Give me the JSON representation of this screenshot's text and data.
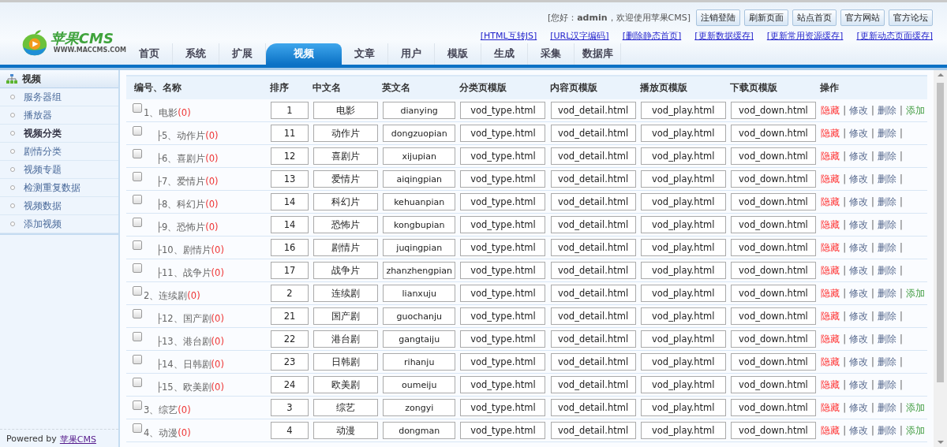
{
  "header": {
    "greeting": "[您好：**admin**，欢迎使用苹果CMS]",
    "buttons": [
      "注销登陆",
      "刷新页面",
      "站点首页",
      "官方网站",
      "官方论坛"
    ],
    "links": [
      "[HTML互转JS]",
      "[URL汉字编码]",
      "[删除静态首页]",
      "[更新数据缓存]",
      "[更新常用资源缓存]",
      "[更新动态页面缓存]"
    ],
    "logo": {
      "name": "苹果CMS",
      "url": "WWW.MACCMS.COM"
    }
  },
  "nav": [
    {
      "label": "首页",
      "selected": false
    },
    {
      "label": "系统",
      "selected": false
    },
    {
      "label": "扩展",
      "selected": false
    },
    {
      "label": "视频",
      "selected": true
    },
    {
      "label": "文章",
      "selected": false
    },
    {
      "label": "用户",
      "selected": false
    },
    {
      "label": "模版",
      "selected": false
    },
    {
      "label": "生成",
      "selected": false
    },
    {
      "label": "采集",
      "selected": false
    },
    {
      "label": "数据库",
      "selected": false
    }
  ],
  "sidebar": {
    "title": "视频",
    "items": [
      {
        "label": "服务器组",
        "selected": false
      },
      {
        "label": "播放器",
        "selected": false
      },
      {
        "label": "视频分类",
        "selected": true
      },
      {
        "label": "剧情分类",
        "selected": false
      },
      {
        "label": "视频专题",
        "selected": false
      },
      {
        "label": "检测重复数据",
        "selected": false
      },
      {
        "label": "视频数据",
        "selected": false
      },
      {
        "label": "添加视频",
        "selected": false
      }
    ],
    "footer": {
      "text": "Powered by",
      "link": "苹果CMS"
    }
  },
  "table": {
    "columns": [
      "编号、名称",
      "排序",
      "中文名",
      "英文名",
      "分类页模版",
      "内容页模版",
      "播放页模版",
      "下载页模版",
      "操作"
    ],
    "categories": [
      {
        "checked": false,
        "label": "1、电影",
        "count": "(0)",
        "sort": "1",
        "cn": "电影",
        "en": "dianying",
        "type": "vod_type.html",
        "detail": "vod_detail.html",
        "play": "vod_play.html",
        "down": "vod_down.html",
        "actions": [
          {
            "kind": "hide",
            "label": "隐藏",
            "sep": "|"
          },
          {
            "kind": "edit",
            "label": "修改",
            "sep": "|"
          },
          {
            "kind": "delete",
            "label": "删除",
            "sep": "|"
          },
          {
            "kind": "add",
            "label": "添加"
          }
        ],
        "children": [
          {
            "checked": false,
            "branch": "├",
            "label": "5、动作片",
            "count": "(0)",
            "sort": "11",
            "cn": "动作片",
            "en": "dongzuopian",
            "type": "vod_type.html",
            "detail": "vod_detail.html",
            "play": "vod_play.html",
            "down": "vod_down.html",
            "actions": [
              {
                "kind": "hide",
                "label": "隐藏",
                "sep": "|"
              },
              {
                "kind": "edit",
                "label": "修改",
                "sep": "|"
              },
              {
                "kind": "delete",
                "label": "删除",
                "sep": "|"
              }
            ]
          },
          {
            "checked": false,
            "branch": "├",
            "label": "6、喜剧片",
            "count": "(0)",
            "sort": "12",
            "cn": "喜剧片",
            "en": "xijupian",
            "type": "vod_type.html",
            "detail": "vod_detail.html",
            "play": "vod_play.html",
            "down": "vod_down.html",
            "actions": [
              {
                "kind": "hide",
                "label": "隐藏",
                "sep": "|"
              },
              {
                "kind": "edit",
                "label": "修改",
                "sep": "|"
              },
              {
                "kind": "delete",
                "label": "删除",
                "sep": "|"
              }
            ]
          },
          {
            "checked": false,
            "branch": "├",
            "label": "7、爱情片",
            "count": "(0)",
            "sort": "13",
            "cn": "爱情片",
            "en": "aiqingpian",
            "type": "vod_type.html",
            "detail": "vod_detail.html",
            "play": "vod_play.html",
            "down": "vod_down.html",
            "actions": [
              {
                "kind": "hide",
                "label": "隐藏",
                "sep": "|"
              },
              {
                "kind": "edit",
                "label": "修改",
                "sep": "|"
              },
              {
                "kind": "delete",
                "label": "删除",
                "sep": "|"
              }
            ]
          },
          {
            "checked": false,
            "branch": "├",
            "label": "8、科幻片",
            "count": "(0)",
            "sort": "14",
            "cn": "科幻片",
            "en": "kehuanpian",
            "type": "vod_type.html",
            "detail": "vod_detail.html",
            "play": "vod_play.html",
            "down": "vod_down.html",
            "actions": [
              {
                "kind": "hide",
                "label": "隐藏",
                "sep": "|"
              },
              {
                "kind": "edit",
                "label": "修改",
                "sep": "|"
              },
              {
                "kind": "delete",
                "label": "删除",
                "sep": "|"
              }
            ]
          },
          {
            "checked": false,
            "branch": "├",
            "label": "9、恐怖片",
            "count": "(0)",
            "sort": "14",
            "cn": "恐怖片",
            "en": "kongbupian",
            "type": "vod_type.html",
            "detail": "vod_detail.html",
            "play": "vod_play.html",
            "down": "vod_down.html",
            "actions": [
              {
                "kind": "hide",
                "label": "隐藏",
                "sep": "|"
              },
              {
                "kind": "edit",
                "label": "修改",
                "sep": "|"
              },
              {
                "kind": "delete",
                "label": "删除",
                "sep": "|"
              }
            ]
          },
          {
            "checked": false,
            "branch": "├",
            "label": "10、剧情片",
            "count": "(0)",
            "sort": "16",
            "cn": "剧情片",
            "en": "juqingpian",
            "type": "vod_type.html",
            "detail": "vod_detail.html",
            "play": "vod_play.html",
            "down": "vod_down.html",
            "actions": [
              {
                "kind": "hide",
                "label": "隐藏",
                "sep": "|"
              },
              {
                "kind": "edit",
                "label": "修改",
                "sep": "|"
              },
              {
                "kind": "delete",
                "label": "删除",
                "sep": "|"
              }
            ]
          },
          {
            "checked": false,
            "branch": "├",
            "label": "11、战争片",
            "count": "(0)",
            "sort": "17",
            "cn": "战争片",
            "en": "zhanzhengpian",
            "type": "vod_type.html",
            "detail": "vod_detail.html",
            "play": "vod_play.html",
            "down": "vod_down.html",
            "actions": [
              {
                "kind": "hide",
                "label": "隐藏",
                "sep": "|"
              },
              {
                "kind": "edit",
                "label": "修改",
                "sep": "|"
              },
              {
                "kind": "delete",
                "label": "删除",
                "sep": "|"
              }
            ]
          }
        ]
      },
      {
        "checked": false,
        "label": "2、连续剧",
        "count": "(0)",
        "sort": "2",
        "cn": "连续剧",
        "en": "lianxuju",
        "type": "vod_type.html",
        "detail": "vod_detail.html",
        "play": "vod_play.html",
        "down": "vod_down.html",
        "actions": [
          {
            "kind": "hide",
            "label": "隐藏",
            "sep": "|"
          },
          {
            "kind": "edit",
            "label": "修改",
            "sep": "|"
          },
          {
            "kind": "delete",
            "label": "删除",
            "sep": "|"
          },
          {
            "kind": "add",
            "label": "添加"
          }
        ],
        "children": [
          {
            "checked": false,
            "branch": "├",
            "label": "12、国产剧",
            "count": "(0)",
            "sort": "21",
            "cn": "国产剧",
            "en": "guochanju",
            "type": "vod_type.html",
            "detail": "vod_detail.html",
            "play": "vod_play.html",
            "down": "vod_down.html",
            "actions": [
              {
                "kind": "hide",
                "label": "隐藏",
                "sep": "|"
              },
              {
                "kind": "edit",
                "label": "修改",
                "sep": "|"
              },
              {
                "kind": "delete",
                "label": "删除",
                "sep": "|"
              }
            ]
          },
          {
            "checked": false,
            "branch": "├",
            "label": "13、港台剧",
            "count": "(0)",
            "sort": "22",
            "cn": "港台剧",
            "en": "gangtaiju",
            "type": "vod_type.html",
            "detail": "vod_detail.html",
            "play": "vod_play.html",
            "down": "vod_down.html",
            "actions": [
              {
                "kind": "hide",
                "label": "隐藏",
                "sep": "|"
              },
              {
                "kind": "edit",
                "label": "修改",
                "sep": "|"
              },
              {
                "kind": "delete",
                "label": "删除",
                "sep": "|"
              }
            ]
          },
          {
            "checked": false,
            "branch": "├",
            "label": "14、日韩剧",
            "count": "(0)",
            "sort": "23",
            "cn": "日韩剧",
            "en": "rihanju",
            "type": "vod_type.html",
            "detail": "vod_detail.html",
            "play": "vod_play.html",
            "down": "vod_down.html",
            "actions": [
              {
                "kind": "hide",
                "label": "隐藏",
                "sep": "|"
              },
              {
                "kind": "edit",
                "label": "修改",
                "sep": "|"
              },
              {
                "kind": "delete",
                "label": "删除",
                "sep": "|"
              }
            ]
          },
          {
            "checked": false,
            "branch": "├",
            "label": "15、欧美剧",
            "count": "(0)",
            "sort": "24",
            "cn": "欧美剧",
            "en": "oumeiju",
            "type": "vod_type.html",
            "detail": "vod_detail.html",
            "play": "vod_play.html",
            "down": "vod_down.html",
            "actions": [
              {
                "kind": "hide",
                "label": "隐藏",
                "sep": "|"
              },
              {
                "kind": "edit",
                "label": "修改",
                "sep": "|"
              },
              {
                "kind": "delete",
                "label": "删除",
                "sep": "|"
              }
            ]
          }
        ]
      },
      {
        "checked": false,
        "label": "3、综艺",
        "count": "(0)",
        "sort": "3",
        "cn": "综艺",
        "en": "zongyi",
        "type": "vod_type.html",
        "detail": "vod_detail.html",
        "play": "vod_play.html",
        "down": "vod_down.html",
        "actions": [
          {
            "kind": "hide",
            "label": "隐藏",
            "sep": "|"
          },
          {
            "kind": "edit",
            "label": "修改",
            "sep": "|"
          },
          {
            "kind": "delete",
            "label": "删除",
            "sep": "|"
          },
          {
            "kind": "add",
            "label": "添加"
          }
        ]
      },
      {
        "checked": false,
        "label": "4、动漫",
        "count": "(0)",
        "sort": "4",
        "cn": "动漫",
        "en": "dongman",
        "type": "vod_type.html",
        "detail": "vod_detail.html",
        "play": "vod_play.html",
        "down": "vod_down.html",
        "actions": [
          {
            "kind": "hide",
            "label": "隐藏",
            "sep": "|"
          },
          {
            "kind": "edit",
            "label": "修改",
            "sep": "|"
          },
          {
            "kind": "delete",
            "label": "删除",
            "sep": "|"
          },
          {
            "kind": "add",
            "label": "添加"
          }
        ]
      }
    ]
  }
}
